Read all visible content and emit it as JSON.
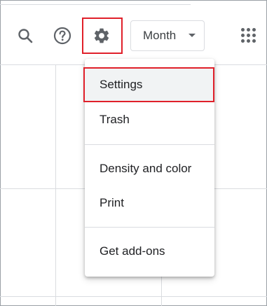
{
  "toolbar": {
    "search_icon": "search-icon",
    "help_icon": "help-icon",
    "settings_icon": "gear-icon",
    "view_select": "Month",
    "apps_icon": "apps-grid-icon"
  },
  "settings_menu": {
    "items": [
      {
        "label": "Settings"
      },
      {
        "label": "Trash"
      },
      {
        "label": "Density and color"
      },
      {
        "label": "Print"
      },
      {
        "label": "Get add-ons"
      }
    ]
  },
  "colors": {
    "highlight": "#e0202a",
    "icon": "#5f6368",
    "hover": "#f1f3f4"
  }
}
